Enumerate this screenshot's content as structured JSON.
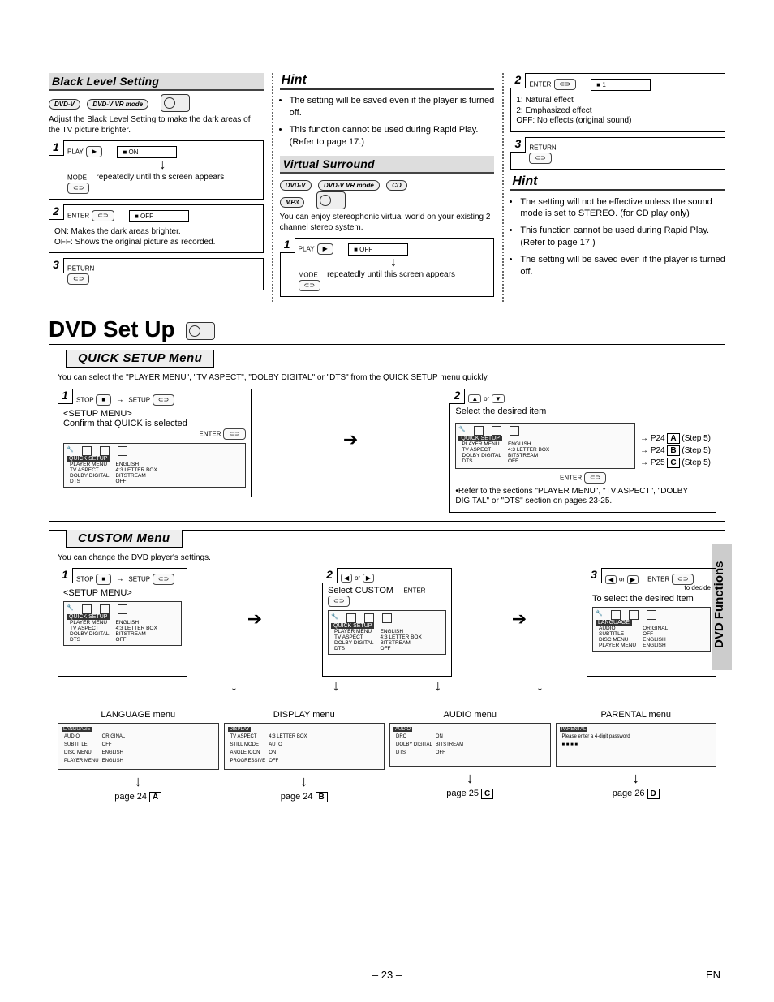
{
  "page_number": "– 23 –",
  "lang_code": "EN",
  "side_tab": "DVD Functions",
  "main_heading": "DVD Set Up",
  "top": {
    "col1": {
      "title": "Black Level Setting",
      "badges": [
        "DVD-V",
        "DVD-V VR mode"
      ],
      "intro": "Adjust the Black Level Setting to make the dark areas of the TV picture brighter.",
      "steps": [
        {
          "n": "1",
          "btn1": "PLAY",
          "screen": "■ ON",
          "arrow_note": "repeatedly until this screen appears",
          "btn2": "MODE"
        },
        {
          "n": "2",
          "btn1": "ENTER",
          "screen": "■ OFF",
          "notes": [
            "ON: Makes the dark areas brighter.",
            "OFF: Shows the original picture as recorded."
          ]
        },
        {
          "n": "3",
          "btn1": "RETURN"
        }
      ]
    },
    "col2": {
      "hint_title": "Hint",
      "hints1": [
        "The setting will be saved even if the player is turned off.",
        "This function cannot be used during Rapid Play. (Refer to page 17.)"
      ],
      "vs_title": "Virtual Surround",
      "vs_badges": [
        "DVD-V",
        "DVD-V VR mode",
        "CD",
        "MP3"
      ],
      "vs_intro": "You can enjoy stereophonic virtual world on your existing 2 channel stereo system.",
      "vs_step": {
        "n": "1",
        "btn1": "PLAY",
        "screen": "■ OFF",
        "btn2": "MODE",
        "note": "repeatedly until this screen appears"
      }
    },
    "col3": {
      "step2": {
        "n": "2",
        "btn": "ENTER",
        "screen": "■ 1",
        "legend": [
          "1: Natural effect",
          "2: Emphasized effect",
          "OFF: No effects (original sound)"
        ]
      },
      "step3": {
        "n": "3",
        "btn": "RETURN"
      },
      "hint_title": "Hint",
      "hints": [
        "The setting will not be effective unless the sound mode is set to STEREO. (for CD play only)",
        "This function cannot be used during Rapid Play. (Refer to page 17.)",
        "The setting will be saved even if the player is turned off."
      ]
    }
  },
  "quick": {
    "tab": "QUICK SETUP Menu",
    "intro": "You can select the \"PLAYER MENU\", \"TV ASPECT\", \"DOLBY DIGITAL\" or \"DTS\" from the QUICK SETUP menu quickly.",
    "step1": {
      "n": "1",
      "stop": "STOP",
      "setup": "SETUP",
      "heading": "<SETUP MENU>",
      "confirm": "Confirm that QUICK is selected",
      "enter": "ENTER",
      "menu_tab": "QUICK SETUP",
      "menu_items": [
        [
          "PLAYER MENU",
          "ENGLISH"
        ],
        [
          "TV ASPECT",
          "4:3 LETTER BOX"
        ],
        [
          "DOLBY DIGITAL",
          "BITSTREAM"
        ],
        [
          "DTS",
          "OFF"
        ]
      ]
    },
    "step2": {
      "n": "2",
      "or": "or",
      "select": "Select the desired item",
      "menu_tab": "QUICK SETUP",
      "menu_items": [
        [
          "PLAYER MENU",
          "ENGLISH"
        ],
        [
          "TV ASPECT",
          "4:3 LETTER BOX"
        ],
        [
          "DOLBY DIGITAL",
          "BITSTREAM"
        ],
        [
          "DTS",
          "OFF"
        ]
      ],
      "refs": [
        {
          "pg": "P24",
          "l": "A",
          "s": "(Step 5)"
        },
        {
          "pg": "P24",
          "l": "B",
          "s": "(Step 5)"
        },
        {
          "pg": "P25",
          "l": "C",
          "s": "(Step 5)"
        }
      ],
      "enter": "ENTER",
      "note": "•Refer to the sections \"PLAYER MENU\", \"TV ASPECT\", \"DOLBY DIGITAL\" or \"DTS\" section on pages 23-25."
    }
  },
  "custom": {
    "tab": "CUSTOM Menu",
    "intro": "You can change the DVD player's settings.",
    "step1": {
      "n": "1",
      "stop": "STOP",
      "setup": "SETUP",
      "heading": "<SETUP MENU>",
      "menu_tab": "QUICK SETUP",
      "menu_items": [
        [
          "PLAYER MENU",
          "ENGLISH"
        ],
        [
          "TV ASPECT",
          "4:3 LETTER BOX"
        ],
        [
          "DOLBY DIGITAL",
          "BITSTREAM"
        ],
        [
          "DTS",
          "OFF"
        ]
      ]
    },
    "step2": {
      "n": "2",
      "or": "or",
      "select": "Select CUSTOM",
      "enter": "ENTER",
      "menu_tab": "QUICK SETUP",
      "menu_items": [
        [
          "PLAYER MENU",
          "ENGLISH"
        ],
        [
          "TV ASPECT",
          "4:3 LETTER BOX"
        ],
        [
          "DOLBY DIGITAL",
          "BITSTREAM"
        ],
        [
          "DTS",
          "OFF"
        ]
      ]
    },
    "step3": {
      "n": "3",
      "or": "or",
      "select": "To select the desired item",
      "decide": "to decide",
      "enter": "ENTER",
      "menu_tab": "LANGUAGE",
      "menu_items": [
        [
          "AUDIO",
          "ORIGINAL"
        ],
        [
          "SUBTITLE",
          "OFF"
        ],
        [
          "DISC MENU",
          "ENGLISH"
        ],
        [
          "PLAYER MENU",
          "ENGLISH"
        ]
      ]
    },
    "four": [
      {
        "title": "LANGUAGE menu",
        "tab": "LANGUAGE",
        "items": [
          [
            "AUDIO",
            "ORIGINAL"
          ],
          [
            "SUBTITLE",
            "OFF"
          ],
          [
            "DISC MENU",
            "ENGLISH"
          ],
          [
            "PLAYER MENU",
            "ENGLISH"
          ]
        ],
        "pg": "page 24",
        "l": "A"
      },
      {
        "title": "DISPLAY menu",
        "tab": "DISPLAY",
        "items": [
          [
            "TV ASPECT",
            "4:3 LETTER BOX"
          ],
          [
            "STILL MODE",
            "AUTO"
          ],
          [
            "ANGLE ICON",
            "ON"
          ],
          [
            "PROGRESSIVE",
            "OFF"
          ]
        ],
        "pg": "page 24",
        "l": "B"
      },
      {
        "title": "AUDIO menu",
        "tab": "AUDIO",
        "items": [
          [
            "DRC",
            "ON"
          ],
          [
            "DOLBY DIGITAL",
            "BITSTREAM"
          ],
          [
            "DTS",
            "OFF"
          ],
          [
            "",
            ""
          ]
        ],
        "pg": "page 25",
        "l": "C"
      },
      {
        "title": "PARENTAL menu",
        "tab": "PARENTAL",
        "items": [
          [
            "Please enter a 4-digit password",
            ""
          ],
          [
            "■ ■ ■ ■",
            ""
          ]
        ],
        "pg": "page 26",
        "l": "D"
      }
    ]
  }
}
